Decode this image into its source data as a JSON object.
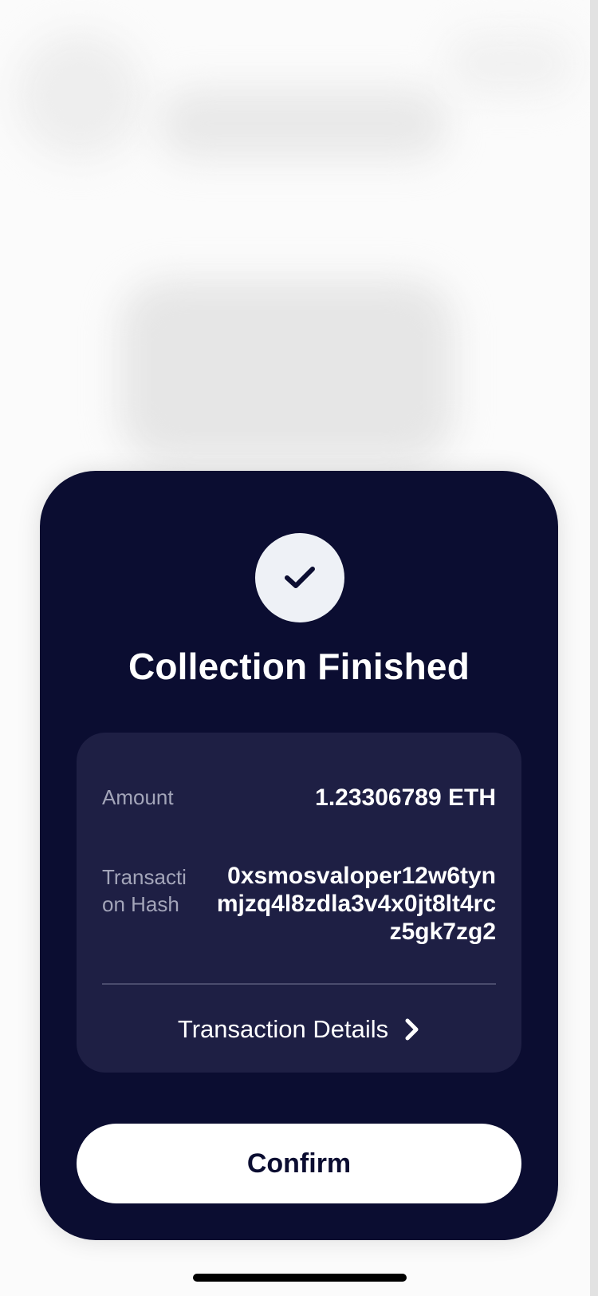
{
  "dialog": {
    "icon": "checkmark-icon",
    "title": "Collection Finished",
    "details": {
      "amount_label": "Amount",
      "amount_value": "1.23306789 ETH",
      "hash_label": "Transaction Hash",
      "hash_value": "0xsmosvaloper12w6tynmjzq4l8zdla3v4x0jt8lt4rcz5gk7zg2",
      "link_label": "Transaction Details",
      "link_icon": "chevron-right-icon"
    },
    "confirm_label": "Confirm"
  },
  "colors": {
    "sheet_background": "#0b0d31",
    "card_background": "#1e1f44",
    "label_text": "#a3a5b9",
    "button_background": "#ffffff",
    "button_text": "#0b0d31"
  }
}
